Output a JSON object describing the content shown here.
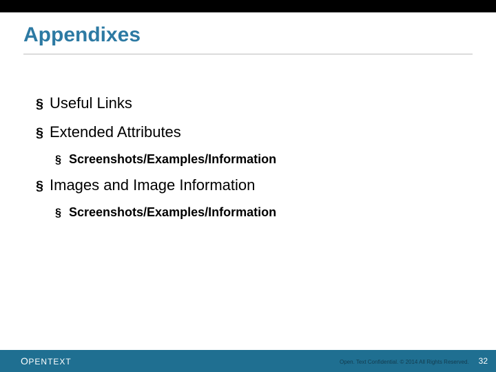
{
  "title": "Appendixes",
  "items": {
    "useful_links": "Useful Links",
    "extended_attributes": "Extended Attributes",
    "extended_attributes_sub": "Screenshots/Examples/Information",
    "images_info": "Images and Image Information",
    "images_info_sub": "Screenshots/Examples/Information"
  },
  "footer": {
    "logo_open": "O",
    "logo_pen": "PEN",
    "logo_text": "TEXT",
    "confidential": "Open. Text Confidential. © 2014 All Rights Reserved.",
    "page": "32"
  },
  "bullet": "§"
}
